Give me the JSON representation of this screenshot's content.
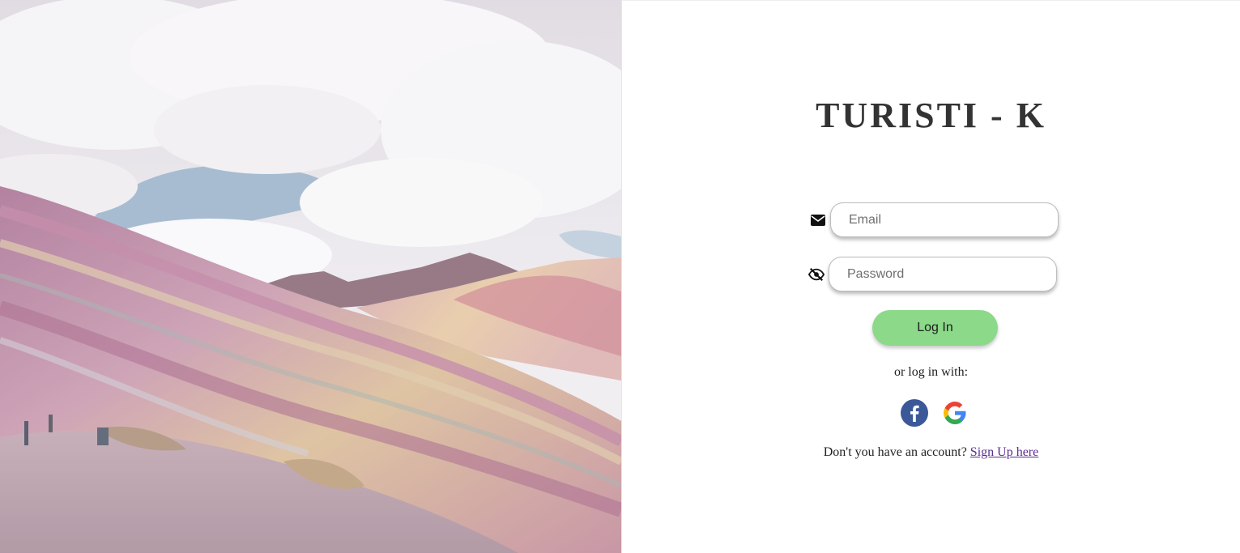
{
  "brand": {
    "title": "TURISTI - K"
  },
  "hero": {
    "alt": "Rainbow Mountain landscape"
  },
  "form": {
    "email": {
      "placeholder": "Email",
      "value": "",
      "icon": "envelope-icon"
    },
    "password": {
      "placeholder": "Password",
      "value": "",
      "icon": "eye-slash-icon"
    },
    "login_label": "Log In",
    "login_color": "#8bd989"
  },
  "social": {
    "prompt": "or log in with:",
    "providers": [
      {
        "name": "Facebook",
        "icon": "facebook-icon",
        "color": "#3b5998"
      },
      {
        "name": "Google",
        "icon": "google-icon",
        "color": "#4285f4"
      }
    ]
  },
  "signup": {
    "prompt": "Don't you have an account?",
    "link_label": "Sign Up here",
    "link_color": "#5b2c8f"
  }
}
